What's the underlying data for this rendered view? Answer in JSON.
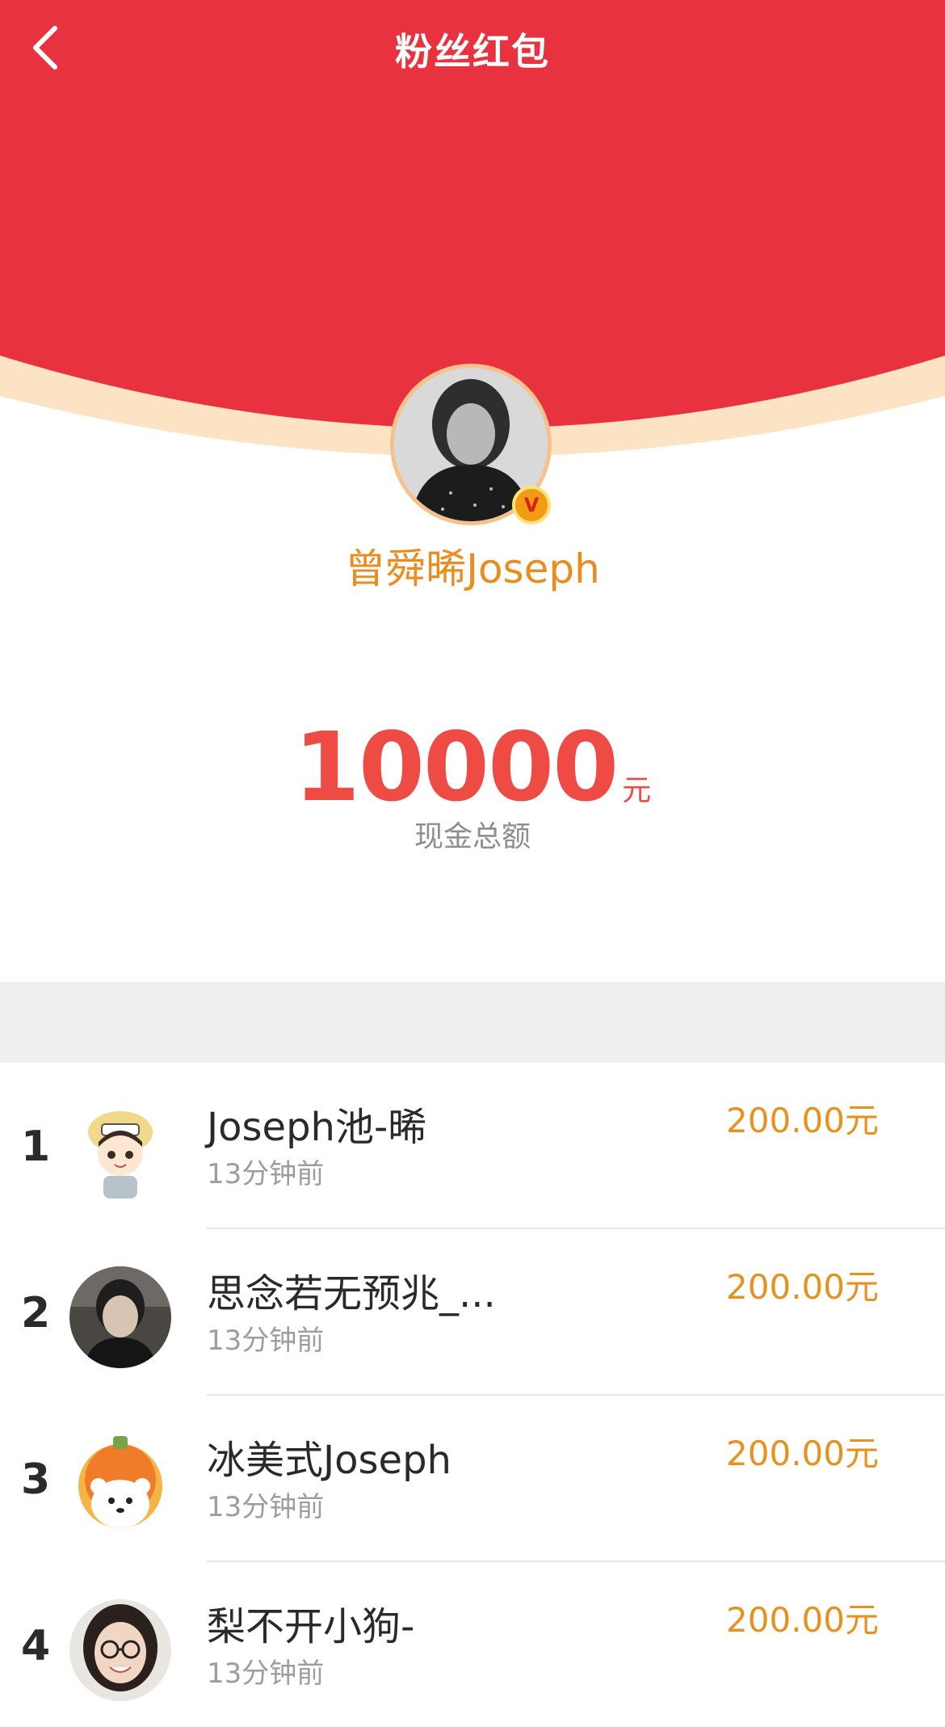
{
  "header": {
    "title": "粉丝红包",
    "back_icon": "chevron-left-icon",
    "background_color": "#e8323f",
    "arc_edge_color": "#fbe3c4"
  },
  "sender": {
    "name": "曾舜晞Joseph",
    "verified_badge": "V",
    "name_color": "#ea8d1e"
  },
  "amount": {
    "value": "10000",
    "unit": "元",
    "caption": "现金总额",
    "color": "#ee4b45"
  },
  "recipients": [
    {
      "rank": "1",
      "name": "Joseph池-晞",
      "time": "13分钟前",
      "amount": "200.00元"
    },
    {
      "rank": "2",
      "name": "思念若无预兆_...",
      "time": "13分钟前",
      "amount": "200.00元"
    },
    {
      "rank": "3",
      "name": "冰美式Joseph",
      "time": "13分钟前",
      "amount": "200.00元"
    },
    {
      "rank": "4",
      "name": "梨不开小狗-",
      "time": "13分钟前",
      "amount": "200.00元"
    }
  ]
}
